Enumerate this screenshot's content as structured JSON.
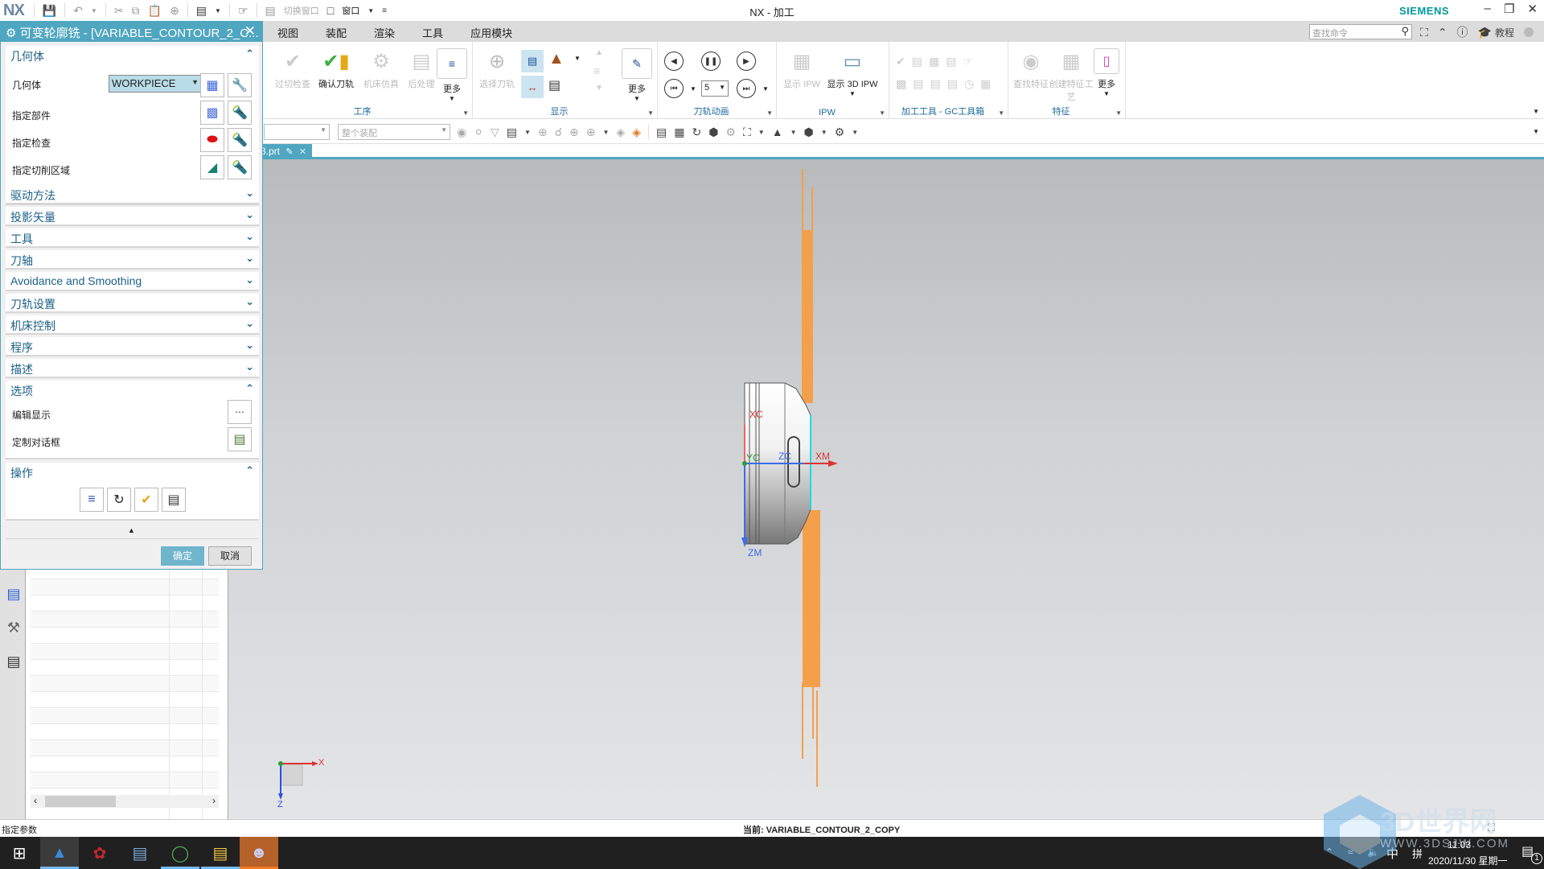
{
  "app": {
    "logo": "NX",
    "window_title": "NX - 加工",
    "brand": "SIEMENS",
    "quick_access": {
      "switch_window_label": "切换窗口",
      "window_label": "窗口"
    },
    "window_controls": [
      "minimize",
      "restore",
      "close"
    ]
  },
  "menu": {
    "items": [
      "视图",
      "装配",
      "渲染",
      "工具",
      "应用模块"
    ],
    "search_placeholder": "查找命令",
    "tutorial_label": "教程"
  },
  "ribbon": {
    "groups": [
      {
        "label": "工序",
        "buttons": [
          {
            "label": "过切检查",
            "enabled": false,
            "icon": "gouge-check-icon"
          },
          {
            "label": "确认刀轨",
            "enabled": true,
            "icon": "verify-toolpath-icon"
          },
          {
            "label": "机床仿真",
            "enabled": false,
            "icon": "machine-simulation-icon"
          },
          {
            "label": "后处理",
            "enabled": false,
            "icon": "postprocess-icon"
          },
          {
            "label": "更多",
            "enabled": true,
            "icon": "more-icon"
          }
        ]
      },
      {
        "label": "显示",
        "buttons": [
          {
            "label": "选择刀轨",
            "enabled": false,
            "icon": "select-toolpath-icon"
          },
          {
            "label": "更多",
            "enabled": true,
            "icon": "more-icon"
          }
        ]
      },
      {
        "label": "刀轨动画",
        "speed_value": "5"
      },
      {
        "label": "IPW",
        "buttons": [
          {
            "label": "显示 IPW",
            "enabled": false,
            "icon": "show-ipw-icon"
          },
          {
            "label": "显示 3D IPW",
            "enabled": true,
            "icon": "show-3d-ipw-icon"
          }
        ]
      },
      {
        "label": "加工工具 - GC工具箱"
      },
      {
        "label": "特征",
        "buttons": [
          {
            "label": "查找特征",
            "enabled": false,
            "icon": "find-feature-icon"
          },
          {
            "label": "创建特征工艺",
            "enabled": false,
            "icon": "create-feature-process-icon"
          },
          {
            "label": "更多",
            "enabled": true,
            "icon": "more-icon"
          }
        ]
      }
    ]
  },
  "toolbar2": {
    "filter_combo": "",
    "scope_combo": "整个装配"
  },
  "file_tab": {
    "label": "3.prt"
  },
  "dialog": {
    "title": "可变轮廓铣 - [VARIABLE_CONTOUR_2_C...",
    "geometry": {
      "header": "几何体",
      "geometry_label": "几何体",
      "geometry_value": "WORKPIECE",
      "rows": [
        "指定部件",
        "指定检查",
        "指定切削区域"
      ]
    },
    "collapsed_sections": [
      "驱动方法",
      "投影矢量",
      "工具",
      "刀轴",
      "Avoidance and Smoothing",
      "刀轨设置",
      "机床控制",
      "程序",
      "描述"
    ],
    "options": {
      "header": "选项",
      "rows": [
        "编辑显示",
        "定制对话框"
      ]
    },
    "actions": {
      "header": "操作"
    },
    "ok_label": "确定",
    "cancel_label": "取消"
  },
  "viewport": {
    "axis_labels": {
      "xc": "XC",
      "yc": "YC",
      "zc": "ZC",
      "xm": "XM",
      "zm": "ZM"
    },
    "triad_labels": {
      "x": "X",
      "z": "Z"
    }
  },
  "status": {
    "prompt": "指定参数",
    "current": "当前: VARIABLE_CONTOUR_2_COPY"
  },
  "taskbar": {
    "time": "11:03",
    "date": "2020/11/30 星期一",
    "ime_lang": "中",
    "ime_mode": "拼",
    "notification_count": "1"
  },
  "watermark": {
    "text": "3D世界网",
    "url": "WWW.3DSJW.COM"
  }
}
